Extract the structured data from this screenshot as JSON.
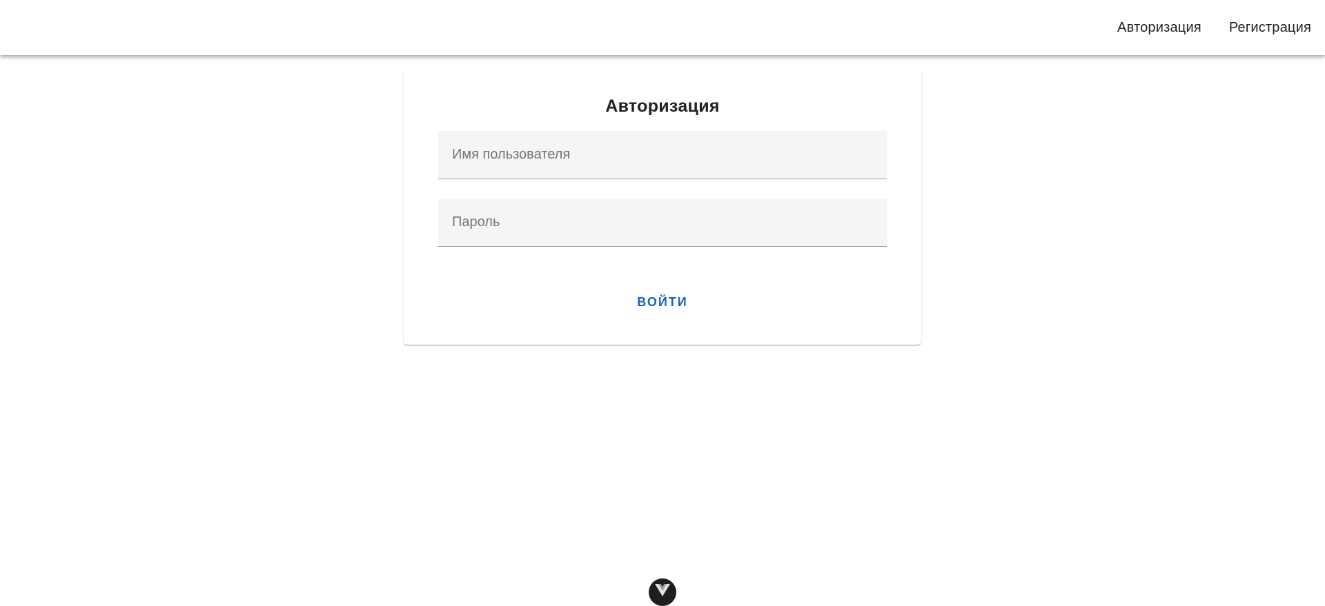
{
  "nav": {
    "items": [
      {
        "label": "Авторизация"
      },
      {
        "label": "Регистрация"
      }
    ]
  },
  "login": {
    "title": "Авторизация",
    "username": {
      "placeholder": "Имя пользователя",
      "value": ""
    },
    "password": {
      "placeholder": "Пароль",
      "value": ""
    },
    "submit_label": "ВОЙТИ"
  },
  "devtools": {
    "icon": "vue-logo-icon"
  },
  "colors": {
    "accent": "#1565c0",
    "field_background": "#f5f5f5",
    "text": "#212121"
  }
}
